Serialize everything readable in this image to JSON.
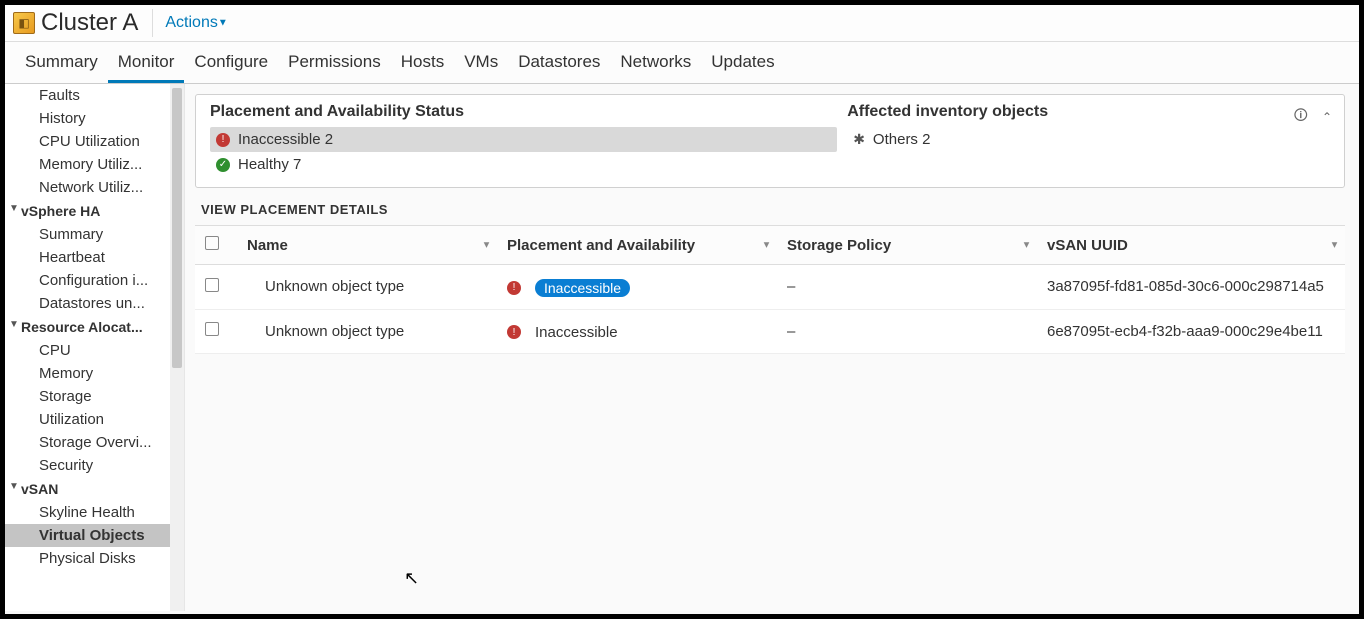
{
  "header": {
    "title": "Cluster A",
    "actions_label": "Actions"
  },
  "tabs": [
    "Summary",
    "Monitor",
    "Configure",
    "Permissions",
    "Hosts",
    "VMs",
    "Datastores",
    "Networks",
    "Updates"
  ],
  "active_tab": "Monitor",
  "sidebar": {
    "top_items": [
      "Faults",
      "History",
      "CPU Utilization",
      "Memory Utiliz...",
      "Network Utiliz..."
    ],
    "groups": [
      {
        "label": "vSphere HA",
        "items": [
          "Summary",
          "Heartbeat",
          "Configuration i...",
          "Datastores un..."
        ]
      },
      {
        "label": "Resource Alocat...",
        "items": [
          "CPU",
          "Memory",
          "Storage",
          "Utilization",
          "Storage Overvi...",
          "Security"
        ]
      },
      {
        "label": "vSAN",
        "items": [
          "Skyline Health",
          "Virtual Objects",
          "Physical Disks"
        ]
      }
    ],
    "active_item": "Virtual Objects"
  },
  "panel": {
    "left_title": "Placement and Availability Status",
    "statuses": [
      {
        "kind": "err",
        "label": "Inaccessible 2",
        "selected": true
      },
      {
        "kind": "ok",
        "label": "Healthy 7",
        "selected": false
      }
    ],
    "right_title": "Affected inventory objects",
    "right_rows": [
      {
        "label": "Others 2"
      }
    ]
  },
  "section_heading": "VIEW PLACEMENT DETAILS",
  "table": {
    "columns": [
      "Name",
      "Placement and Availability",
      "Storage Policy",
      "vSAN UUID"
    ],
    "rows": [
      {
        "name": "Unknown object type",
        "status": "Inaccessible",
        "highlight": true,
        "policy": "–",
        "uuid": "3a87095f-fd81-085d-30c6-000c298714a5"
      },
      {
        "name": "Unknown object type",
        "status": "Inaccessible",
        "highlight": false,
        "policy": "–",
        "uuid": "6e87095t-ecb4-f32b-aaa9-000c29e4be11"
      }
    ]
  }
}
